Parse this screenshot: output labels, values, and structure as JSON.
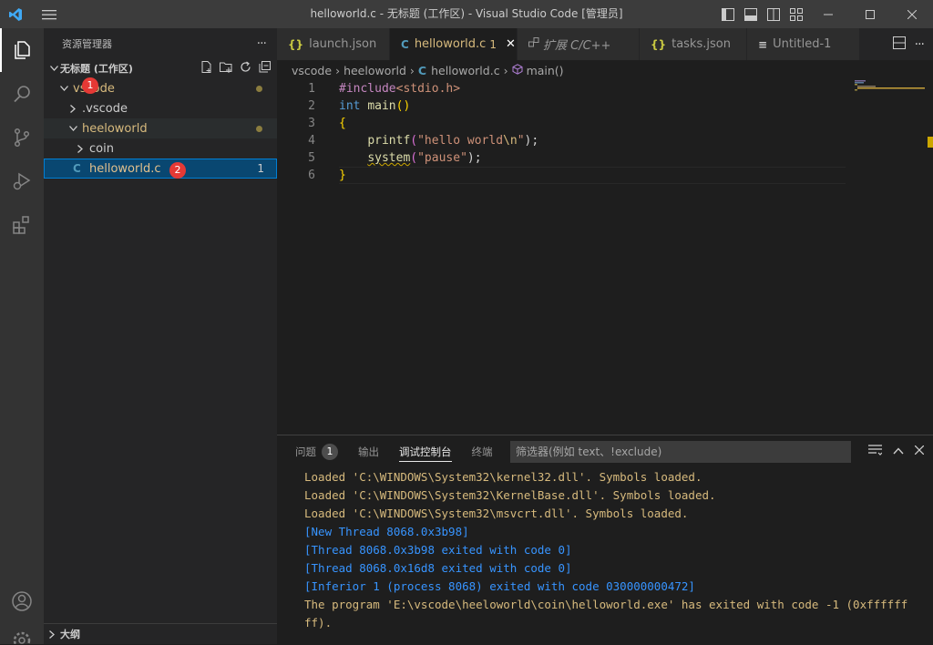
{
  "window": {
    "title": "helloworld.c - 无标题 (工作区) - Visual Studio Code [管理员]"
  },
  "sidebar": {
    "header": "资源管理器",
    "more": "···",
    "workspace": "无标题 (工作区)",
    "tree": [
      {
        "label": "vscode",
        "indent": 0
      },
      {
        "label": ".vscode",
        "indent": 1
      },
      {
        "label": "heeloworld",
        "indent": 1
      },
      {
        "label": "coin",
        "indent": 2
      },
      {
        "label": "helloworld.c",
        "indent": 2,
        "errors": "1"
      }
    ],
    "outline": "大纲"
  },
  "badges": [
    "1",
    "2"
  ],
  "tabs": [
    {
      "icon": "{}",
      "label": "launch.json"
    },
    {
      "icon": "C",
      "label": "helloworld.c",
      "suffix": "1",
      "close": "✕"
    },
    {
      "icon": "扩展",
      "label": "扩展 C/C++"
    },
    {
      "icon": "{}",
      "label": "tasks.json"
    },
    {
      "icon": "≡",
      "label": "Untitled-1"
    }
  ],
  "breadcrumbs": [
    "vscode",
    "heeloworld",
    "helloworld.c",
    "main()"
  ],
  "code": {
    "line_numbers": [
      "1",
      "2",
      "3",
      "4",
      "5",
      "6"
    ],
    "l1_a": "#include",
    "l1_b": "<stdio.h>",
    "l2_a": "int",
    "l2_b": "main",
    "l2_c": "()",
    "l3": "{",
    "l4_a": "printf",
    "l4_b": "(",
    "l4_c": "\"hello world",
    "l4_d": "\\n",
    "l4_e": "\"",
    "l4_f": ");",
    "l5_a": "system",
    "l5_b": "(",
    "l5_c": "\"pause\"",
    "l5_d": ");",
    "l6": "}"
  },
  "panel": {
    "tabs": [
      "问题",
      "输出",
      "调试控制台",
      "终端"
    ],
    "problems_count": "1",
    "filter_placeholder": "筛选器(例如 text、!exclude)",
    "console": [
      {
        "text": "Loaded 'C:\\WINDOWS\\System32\\kernel32.dll'. Symbols loaded.",
        "color": "orange"
      },
      {
        "text": "Loaded 'C:\\WINDOWS\\System32\\KernelBase.dll'. Symbols loaded.",
        "color": "orange"
      },
      {
        "text": "Loaded 'C:\\WINDOWS\\System32\\msvcrt.dll'. Symbols loaded.",
        "color": "orange"
      },
      {
        "text": "[New Thread 8068.0x3b98]",
        "color": "blue"
      },
      {
        "text": "[Thread 8068.0x3b98 exited with code 0]",
        "color": "blue"
      },
      {
        "text": "[Thread 8068.0x16d8 exited with code 0]",
        "color": "blue"
      },
      {
        "text": "[Inferior 1 (process 8068) exited with code 030000000472]",
        "color": "blue"
      },
      {
        "text": "The program 'E:\\vscode\\heeloworld\\coin\\helloworld.exe' has exited with code -1 (0xffffff",
        "color": "orange"
      },
      {
        "text": "ff).",
        "color": "orange"
      }
    ]
  },
  "colors": {
    "accent": "#007fd4",
    "modified": "#d7ba7d",
    "badge": "#e53935"
  }
}
